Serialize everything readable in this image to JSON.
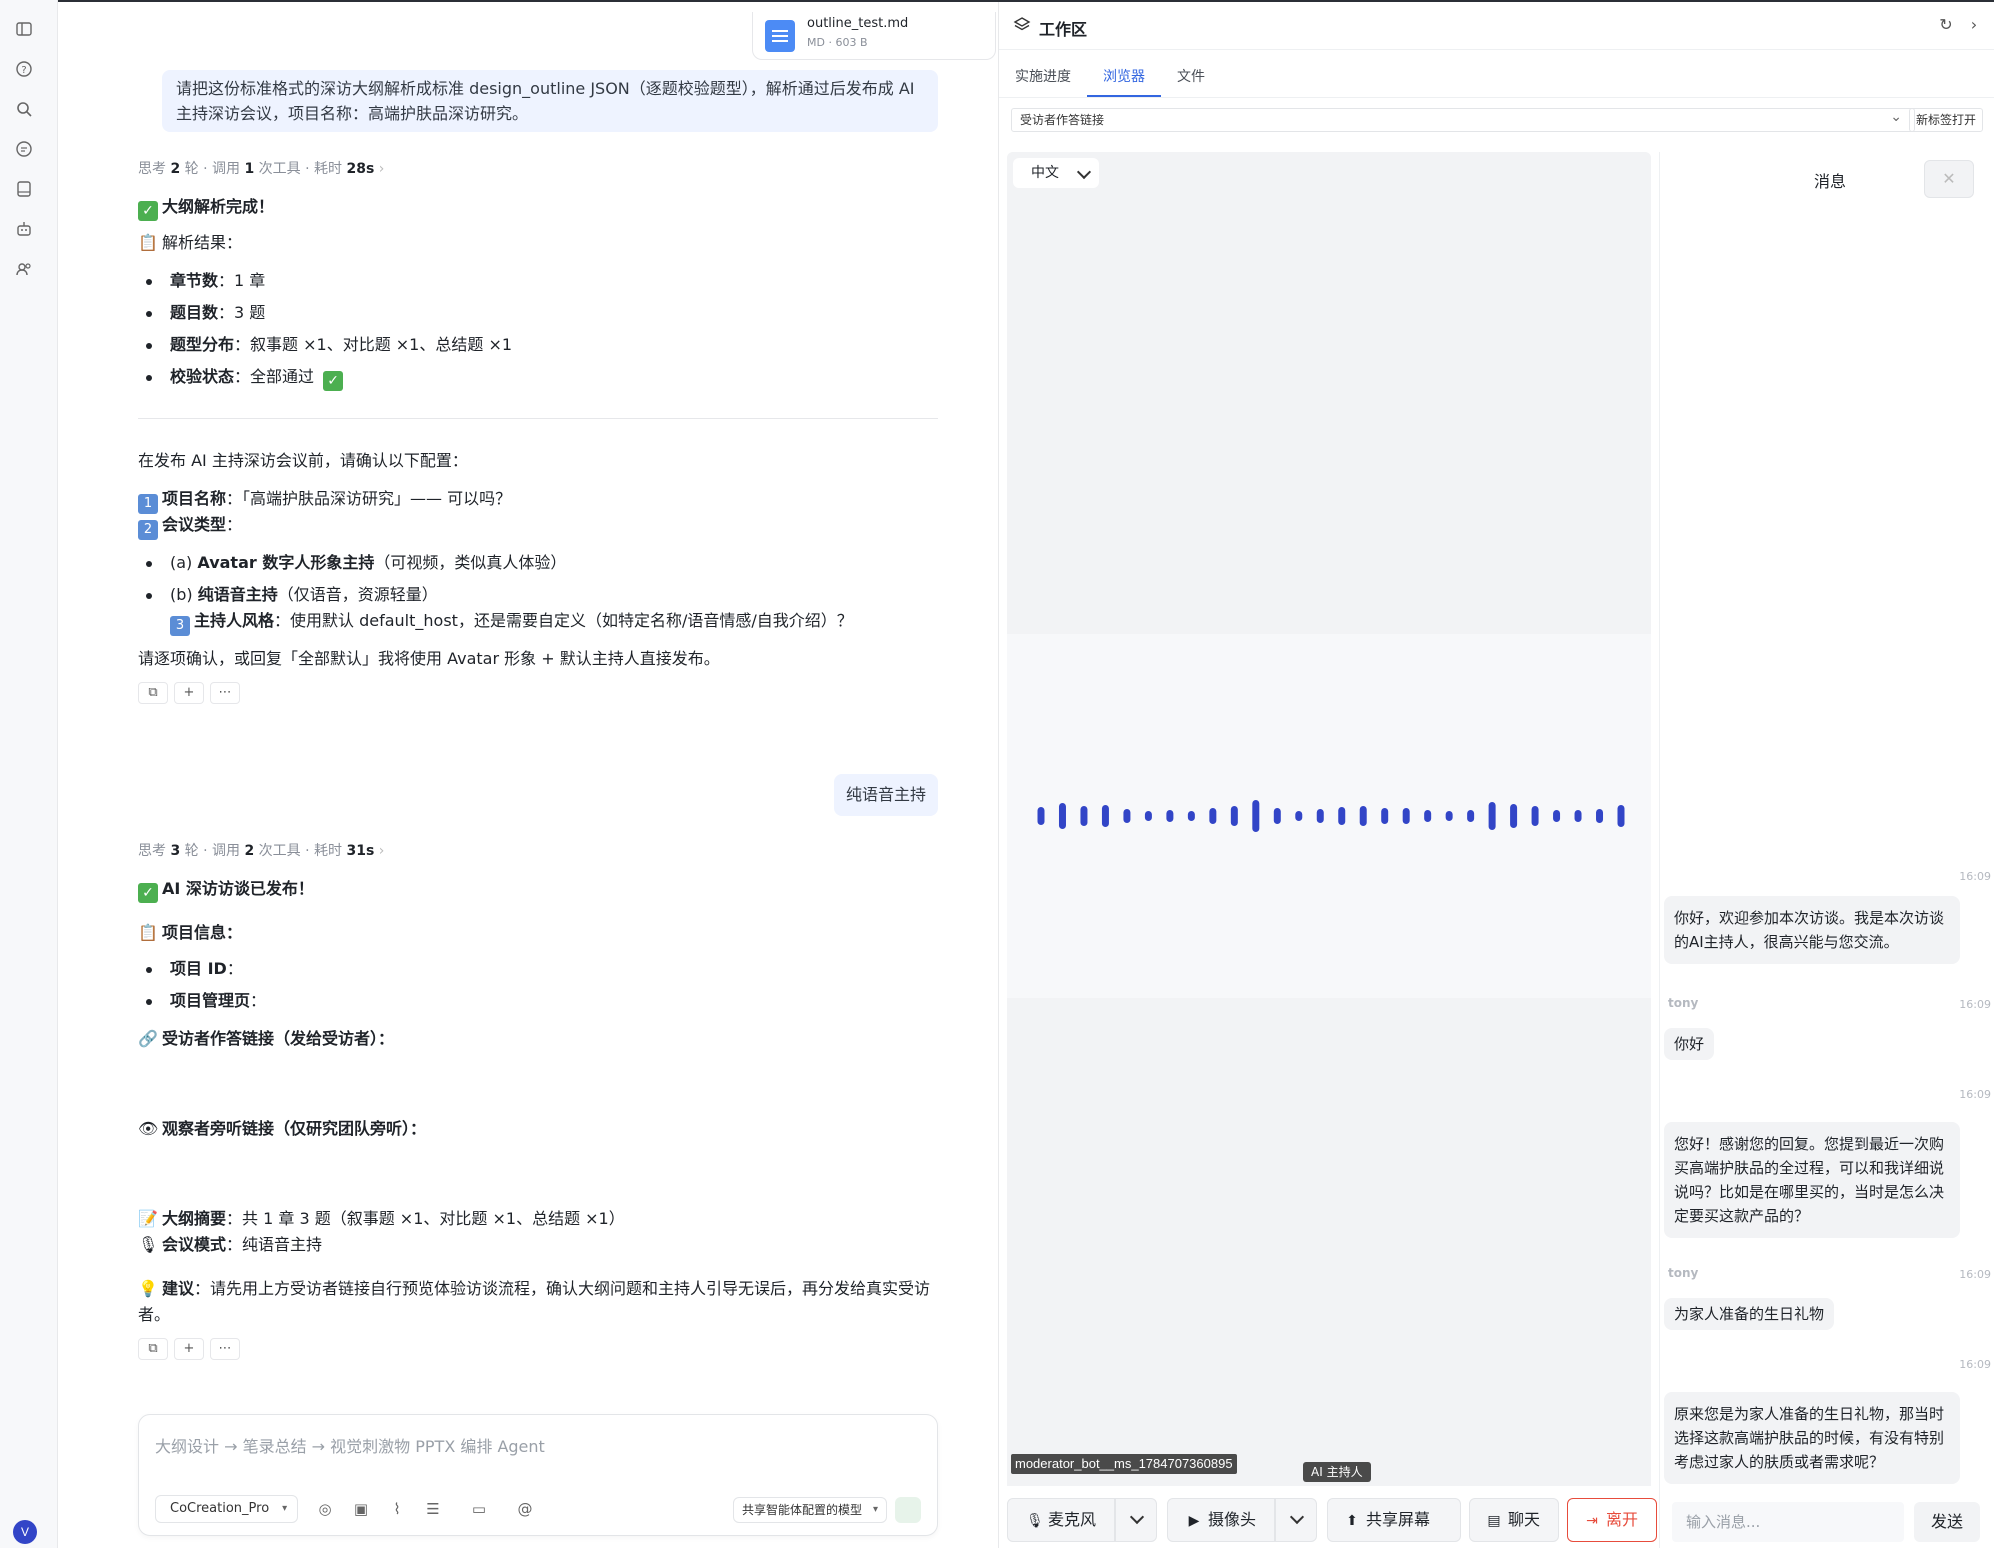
{
  "file": {
    "name": "outline_test.md",
    "meta": "MD · 603 B"
  },
  "msg1": {
    "user": "请把这份标准格式的深访大纲解析成标准 design_outline JSON（逐题校验题型），解析通过后发布成 AI 主持深访会议，项目名称：高端护肤品深访研究。",
    "meta_prefix": "思考 ",
    "meta_rounds": "2",
    "meta_mid": " 轮 · 调用 ",
    "meta_tools": "1",
    "meta_mid2": " 次工具 · 耗时 ",
    "meta_time": "28s",
    "done": "大纲解析完成！",
    "result_label": "解析结果：",
    "bullets": [
      {
        "k": "章节数",
        "v": "：1 章"
      },
      {
        "k": "题目数",
        "v": "：3 题"
      },
      {
        "k": "题型分布",
        "v": "：叙事题 ×1、对比题 ×1、总结题 ×1"
      },
      {
        "k": "校验状态",
        "v": "：全部通过 "
      }
    ],
    "confirm_intro": "在发布 AI 主持深访会议前，请确认以下配置：",
    "item1_k": "项目名称",
    "item1_v": "：「高端护肤品深访研究」—— 可以吗？",
    "item2_k": "会议类型",
    "item2_v": "：",
    "opt_a_pre": "(a) ",
    "opt_a_k": "Avatar 数字人形象主持",
    "opt_a_v": "（可视频，类似真人体验）",
    "opt_b_pre": "(b) ",
    "opt_b_k": "纯语音主持",
    "opt_b_v": "（仅语音，资源轻量）",
    "item3_k": "主持人风格",
    "item3_v": "：使用默认 default_host，还是需要自定义（如特定名称/语音情感/自我介绍）？",
    "closing": "请逐项确认，或回复「全部默认」我将使用 Avatar 形象 + 默认主持人直接发布。"
  },
  "msg2": {
    "user": "纯语音主持",
    "meta_prefix": "思考 ",
    "meta_rounds": "3",
    "meta_mid": " 轮 · 调用 ",
    "meta_tools": "2",
    "meta_mid2": " 次工具 · 耗时 ",
    "meta_time": "31s",
    "done": "AI 深访访谈已发布！",
    "info_label": "项目信息：",
    "bullets": [
      {
        "k": "项目 ID",
        "v": "："
      },
      {
        "k": "项目管理页",
        "v": "："
      }
    ],
    "respondent_link": "受访者作答链接（发给受访者）：",
    "observer_link": "观察者旁听链接（仅研究团队旁听）：",
    "summary_k": "大纲摘要",
    "summary_v": "：共 1 章 3 题（叙事题 ×1、对比题 ×1、总结题 ×1）",
    "mode_k": "会议模式",
    "mode_v": "：纯语音主持",
    "advice_k": "建议",
    "advice_v": "：请先用上方受访者链接自行预览体验访谈流程，确认大纲问题和主持人引导无误后，再分发给真实受访者。"
  },
  "actions": {
    "copy": "⧉",
    "add": "+",
    "more": "⋯"
  },
  "numbers": {
    "n1": "1",
    "n2": "2",
    "n3": "3"
  },
  "composer": {
    "placeholder": "大纲设计 → 笔录总结 → 视觉刺激物 PPTX 编排 Agent",
    "model": "CoCreation_Pro",
    "share_model": "共享智能体配置的模型"
  },
  "rail": {
    "avatar": "V"
  },
  "workspace": {
    "title": "工作区",
    "tabs": [
      "实施进度",
      "浏览器",
      "文件"
    ],
    "url": "受访者作答链接",
    "new_tab": "新标签打开",
    "lang": "中文",
    "bot_label": "moderator_bot__ms_1784707360895",
    "ai_tag": "AI 主持人",
    "controls": {
      "mic": "麦克风",
      "camera": "摄像头",
      "share": "共享屏幕",
      "chat": "聊天",
      "leave": "离开"
    },
    "wave_levels": [
      0.45,
      0.65,
      0.5,
      0.55,
      0.35,
      0.25,
      0.3,
      0.25,
      0.4,
      0.5,
      0.8,
      0.4,
      0.25,
      0.35,
      0.45,
      0.5,
      0.4,
      0.4,
      0.3,
      0.25,
      0.3,
      0.7,
      0.6,
      0.5,
      0.3,
      0.3,
      0.35,
      0.55
    ],
    "accent": "#3245c7"
  },
  "messages": {
    "title": "消息",
    "close": "✕",
    "items": [
      {
        "time": "16:09",
        "text": "你好，欢迎参加本次访谈。我是本次访谈的AI主持人，很高兴能与您交流。"
      },
      {
        "sender": "tony",
        "time": "16:09",
        "text": "你好"
      },
      {
        "time": "16:09",
        "text": "您好！感谢您的回复。您提到最近一次购买高端护肤品的全过程，可以和我详细说说吗？比如是在哪里买的，当时是怎么决定要买这款产品的？"
      },
      {
        "sender": "tony",
        "time": "16:09",
        "text": "为家人准备的生日礼物"
      },
      {
        "time": "16:09",
        "text": "原来您是为家人准备的生日礼物，那当时选择这款高端护肤品的时候，有没有特别考虑过家人的肤质或者需求呢？"
      }
    ],
    "input_placeholder": "输入消息...",
    "send": "发送"
  }
}
